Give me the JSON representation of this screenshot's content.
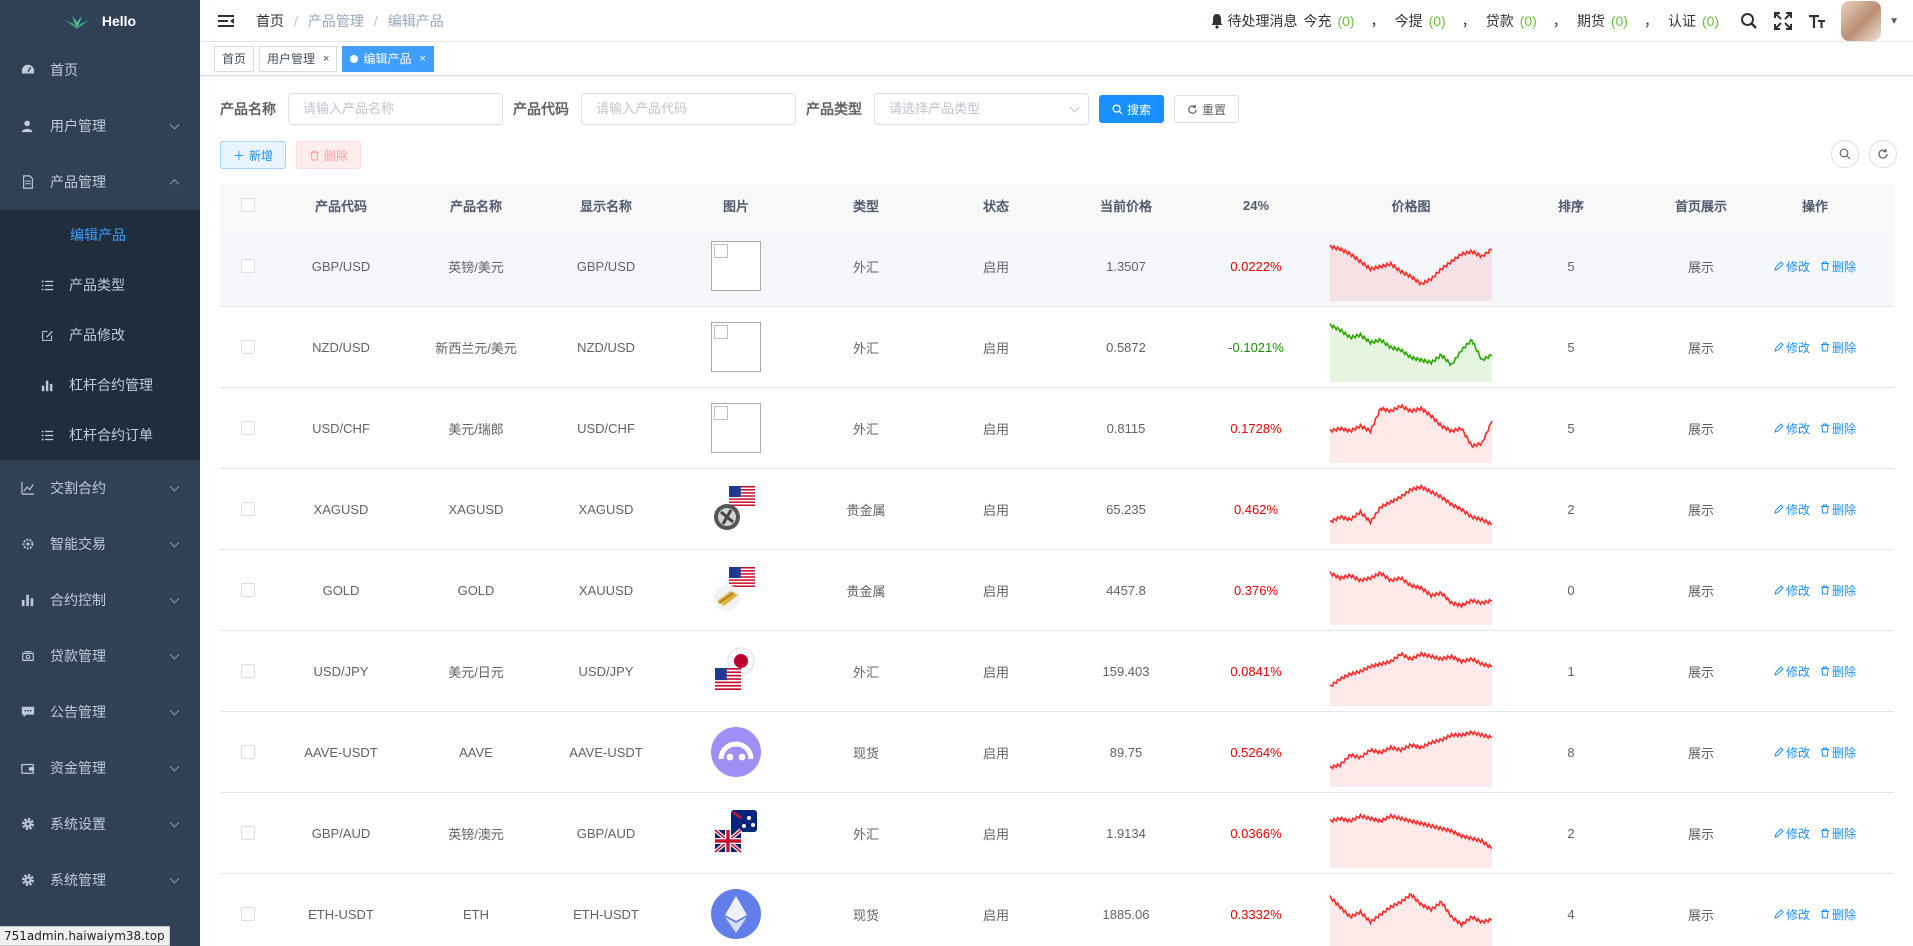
{
  "sidebar": {
    "logo_text": "Hello",
    "items": [
      {
        "label": "首页",
        "icon": "dashboard-icon"
      },
      {
        "label": "用户管理",
        "icon": "user-icon"
      },
      {
        "label": "产品管理",
        "icon": "document-icon",
        "expanded": true
      },
      {
        "label": "交割合约",
        "icon": "chart-line-icon"
      },
      {
        "label": "智能交易",
        "icon": "cog-icon"
      },
      {
        "label": "合约控制",
        "icon": "bar-chart-icon"
      },
      {
        "label": "贷款管理",
        "icon": "money-icon"
      },
      {
        "label": "公告管理",
        "icon": "message-icon"
      },
      {
        "label": "资金管理",
        "icon": "wallet-icon"
      },
      {
        "label": "系统设置",
        "icon": "gear-icon"
      },
      {
        "label": "系统管理",
        "icon": "gear-icon"
      }
    ],
    "submenu": [
      {
        "label": "编辑产品",
        "active": true
      },
      {
        "label": "产品类型",
        "icon": "list-icon"
      },
      {
        "label": "产品修改",
        "icon": "edit-icon"
      },
      {
        "label": "杠杆合约管理",
        "icon": "bar-chart-icon"
      },
      {
        "label": "杠杆合约订单",
        "icon": "list-icon"
      }
    ],
    "status_url": "751admin.haiwaiym38.top"
  },
  "header": {
    "breadcrumb": [
      "首页",
      "产品管理",
      "编辑产品"
    ],
    "notice_label": "待处理消息",
    "counters": [
      {
        "label": "今充",
        "value": "(0)"
      },
      {
        "label": "今提",
        "value": "(0)"
      },
      {
        "label": "贷款",
        "value": "(0)"
      },
      {
        "label": "期货",
        "value": "(0)"
      },
      {
        "label": "认证",
        "value": "(0)"
      }
    ],
    "separator": "，"
  },
  "tags": [
    {
      "label": "首页",
      "active": false,
      "closable": false
    },
    {
      "label": "用户管理",
      "active": false,
      "closable": true
    },
    {
      "label": "编辑产品",
      "active": true,
      "closable": true
    }
  ],
  "search": {
    "name_label": "产品名称",
    "name_placeholder": "请输入产品名称",
    "code_label": "产品代码",
    "code_placeholder": "请输入产品代码",
    "type_label": "产品类型",
    "type_placeholder": "请选择产品类型",
    "search_btn": "搜索",
    "reset_btn": "重置"
  },
  "toolbar": {
    "add_btn": "新增",
    "delete_btn": "删除"
  },
  "table": {
    "columns": [
      "产品代码",
      "产品名称",
      "显示名称",
      "图片",
      "类型",
      "状态",
      "当前价格",
      "24%",
      "价格图",
      "排序",
      "首页展示",
      "操作"
    ],
    "edit_label": "修改",
    "delete_label": "删除",
    "rows": [
      {
        "code": "GBP/USD",
        "name": "英镑/美元",
        "display": "GBP/USD",
        "image": "broken",
        "type": "外汇",
        "status": "启用",
        "price": "1.3507",
        "pct": "0.0222%",
        "trend": "up",
        "spark": [
          0.15,
          0.2,
          0.3,
          0.45,
          0.6,
          0.55,
          0.5,
          0.65,
          0.75,
          0.9,
          0.8,
          0.6,
          0.45,
          0.3,
          0.25,
          0.35,
          0.2
        ],
        "sort": "5",
        "home": "展示"
      },
      {
        "code": "NZD/USD",
        "name": "新西兰元/美元",
        "display": "NZD/USD",
        "image": "broken",
        "type": "外汇",
        "status": "启用",
        "price": "0.5872",
        "pct": "-0.1021%",
        "trend": "down",
        "spark": [
          0.1,
          0.2,
          0.35,
          0.3,
          0.45,
          0.4,
          0.55,
          0.6,
          0.75,
          0.8,
          0.85,
          0.7,
          0.9,
          0.6,
          0.4,
          0.8,
          0.7
        ],
        "sort": "5",
        "home": "展示"
      },
      {
        "code": "USD/CHF",
        "name": "美元/瑞郎",
        "display": "USD/CHF",
        "image": "broken",
        "type": "外汇",
        "status": "启用",
        "price": "0.8115",
        "pct": "0.1728%",
        "trend": "up",
        "spark": [
          0.6,
          0.55,
          0.6,
          0.5,
          0.6,
          0.15,
          0.2,
          0.1,
          0.2,
          0.15,
          0.3,
          0.5,
          0.6,
          0.55,
          0.9,
          0.85,
          0.4
        ],
        "sort": "5",
        "home": "展示"
      },
      {
        "code": "XAGUSD",
        "name": "XAGUSD",
        "display": "XAGUSD",
        "image": "flag-us-silver",
        "type": "贵金属",
        "status": "启用",
        "price": "65.235",
        "pct": "0.462%",
        "trend": "up",
        "spark": [
          0.8,
          0.7,
          0.75,
          0.6,
          0.8,
          0.5,
          0.4,
          0.3,
          0.15,
          0.1,
          0.2,
          0.3,
          0.45,
          0.55,
          0.7,
          0.75,
          0.85
        ],
        "sort": "2",
        "home": "展示"
      },
      {
        "code": "GOLD",
        "name": "GOLD",
        "display": "XAUUSD",
        "image": "flag-us-gold",
        "type": "贵金属",
        "status": "启用",
        "price": "4457.8",
        "pct": "0.376%",
        "trend": "up",
        "spark": [
          0.2,
          0.3,
          0.25,
          0.35,
          0.3,
          0.2,
          0.35,
          0.3,
          0.45,
          0.5,
          0.65,
          0.6,
          0.8,
          0.85,
          0.75,
          0.8,
          0.75
        ],
        "sort": "0",
        "home": "展示"
      },
      {
        "code": "USD/JPY",
        "name": "美元/日元",
        "display": "USD/JPY",
        "image": "flag-us-jp",
        "type": "外汇",
        "status": "启用",
        "price": "159.403",
        "pct": "0.0841%",
        "trend": "up",
        "spark": [
          0.85,
          0.7,
          0.6,
          0.55,
          0.45,
          0.4,
          0.35,
          0.2,
          0.3,
          0.2,
          0.25,
          0.3,
          0.25,
          0.35,
          0.3,
          0.4,
          0.45
        ],
        "sort": "1",
        "home": "展示"
      },
      {
        "code": "AAVE-USDT",
        "name": "AAVE",
        "display": "AAVE-USDT",
        "image": "coin-aave",
        "type": "现货",
        "status": "启用",
        "price": "89.75",
        "pct": "0.5264%",
        "trend": "up",
        "spark": [
          0.85,
          0.8,
          0.6,
          0.65,
          0.5,
          0.55,
          0.45,
          0.5,
          0.4,
          0.45,
          0.35,
          0.3,
          0.2,
          0.2,
          0.15,
          0.2,
          0.25
        ],
        "sort": "8",
        "home": "展示"
      },
      {
        "code": "GBP/AUD",
        "name": "英镑/澳元",
        "display": "GBP/AUD",
        "image": "flag-gb-au",
        "type": "外汇",
        "status": "启用",
        "price": "1.9134",
        "pct": "0.0366%",
        "trend": "up",
        "spark": [
          0.3,
          0.25,
          0.3,
          0.2,
          0.25,
          0.3,
          0.2,
          0.25,
          0.3,
          0.35,
          0.4,
          0.45,
          0.5,
          0.6,
          0.65,
          0.7,
          0.85
        ],
        "sort": "2",
        "home": "展示"
      },
      {
        "code": "ETH-USDT",
        "name": "ETH",
        "display": "ETH-USDT",
        "image": "coin-eth",
        "type": "现货",
        "status": "启用",
        "price": "1885.06",
        "pct": "0.3332%",
        "trend": "up",
        "spark": [
          0.2,
          0.4,
          0.6,
          0.5,
          0.7,
          0.55,
          0.4,
          0.3,
          0.15,
          0.35,
          0.45,
          0.3,
          0.6,
          0.75,
          0.6,
          0.7,
          0.65
        ],
        "sort": "4",
        "home": "展示"
      }
    ]
  },
  "colors": {
    "sidebar_bg": "#304156",
    "submenu_bg": "#1f2d3d",
    "primary": "#1890ff",
    "up": "#e60000",
    "down": "#1a8f00",
    "counter_green": "#67c23a"
  }
}
